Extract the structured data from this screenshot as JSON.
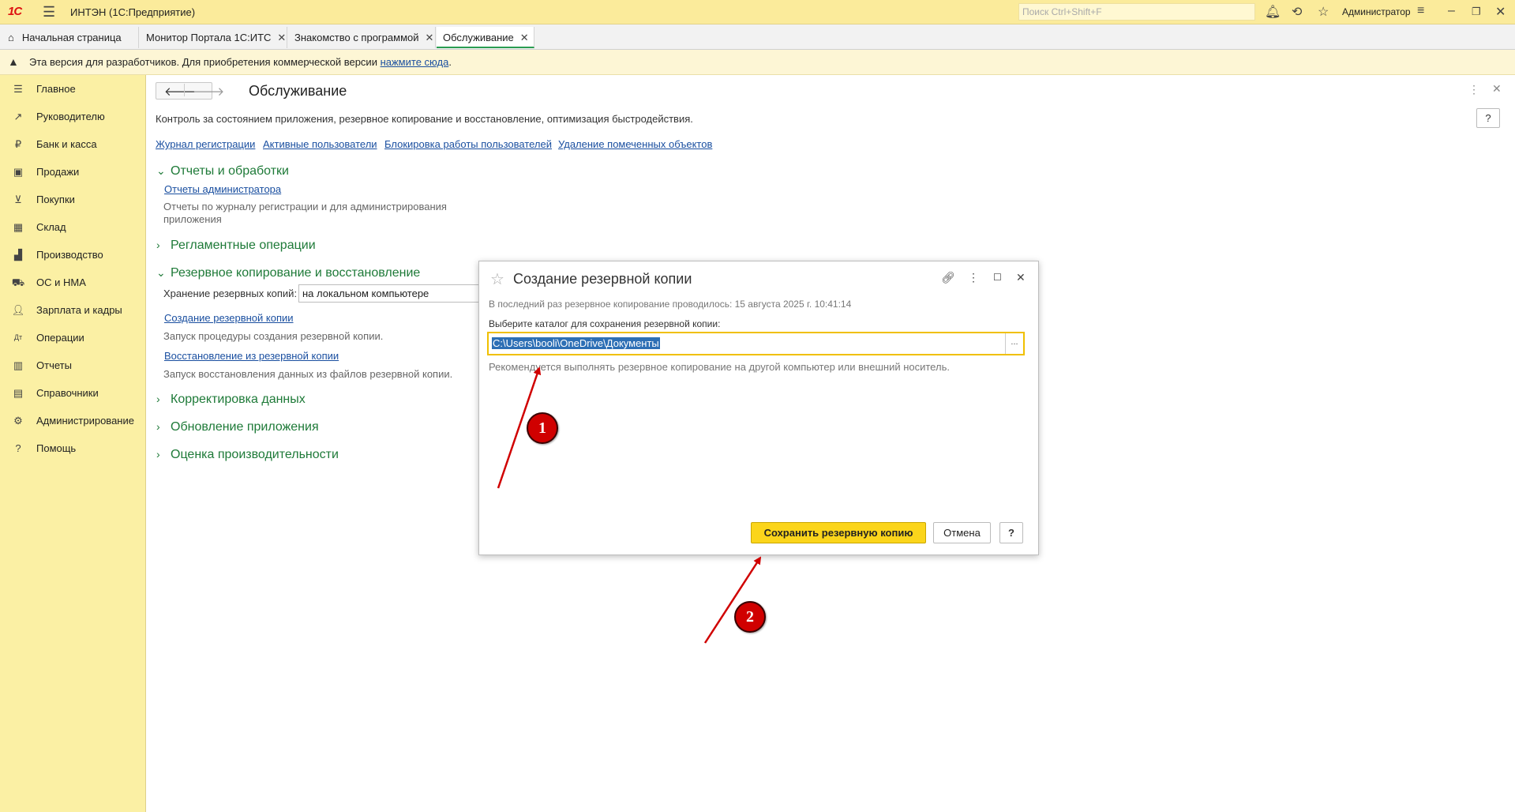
{
  "titlebar": {
    "logo": "1С",
    "app_title": "ИНТЭН  (1С:Предприятие)",
    "search_placeholder": "Поиск Ctrl+Shift+F",
    "user": "Администратор"
  },
  "tabs": [
    {
      "label": "Начальная страница"
    },
    {
      "label": "Монитор Портала 1С:ИТС"
    },
    {
      "label": "Знакомство с программой"
    },
    {
      "label": "Обслуживание"
    }
  ],
  "notice": {
    "text": "Эта версия для разработчиков. Для приобретения коммерческой версии ",
    "link": "нажмите сюда",
    "suffix": "."
  },
  "sidebar": {
    "items": [
      {
        "label": "Главное",
        "icon": "menu-icon"
      },
      {
        "label": "Руководителю",
        "icon": "trend-icon"
      },
      {
        "label": "Банк и касса",
        "icon": "ruble-icon"
      },
      {
        "label": "Продажи",
        "icon": "bag-icon"
      },
      {
        "label": "Покупки",
        "icon": "cart-icon"
      },
      {
        "label": "Склад",
        "icon": "grid-icon"
      },
      {
        "label": "Производство",
        "icon": "factory-icon"
      },
      {
        "label": "ОС и НМА",
        "icon": "truck-icon"
      },
      {
        "label": "Зарплата и кадры",
        "icon": "person-icon"
      },
      {
        "label": "Операции",
        "icon": "dt-kt-icon"
      },
      {
        "label": "Отчеты",
        "icon": "bar-chart-icon"
      },
      {
        "label": "Справочники",
        "icon": "book-icon"
      },
      {
        "label": "Администрирование",
        "icon": "gear-icon"
      },
      {
        "label": "Помощь",
        "icon": "question-icon"
      }
    ]
  },
  "page": {
    "title": "Обслуживание",
    "help": "?",
    "description": "Контроль за состоянием приложения, резервное копирование и восстановление, оптимизация быстродействия.",
    "links": [
      "Журнал регистрации",
      "Активные пользователи",
      "Блокировка работы пользователей",
      "Удаление помеченных объектов"
    ],
    "sections": {
      "reports": {
        "title": "Отчеты и обработки",
        "link": "Отчеты администратора",
        "desc": "Отчеты по журналу регистрации и для администрирования приложения"
      },
      "scheduled": {
        "title": "Регламентные операции"
      },
      "backup": {
        "title": "Резервное копирование и восстановление",
        "storage_label": "Хранение резервных копий:",
        "storage_value": "на локальном компьютере",
        "create_link": "Создание резервной копии",
        "create_desc": "Запуск процедуры создания резервной копии.",
        "restore_link": "Восстановление из резервной копии",
        "restore_desc": "Запуск восстановления данных из файлов резервной копии."
      },
      "data_fix": {
        "title": "Корректировка данных"
      },
      "update": {
        "title": "Обновление приложения"
      },
      "perf": {
        "title": "Оценка производительности"
      }
    }
  },
  "dialog": {
    "title": "Создание резервной копии",
    "last_backup": "В последний раз резервное копирование проводилось: 15 августа 2025 г. 10:41:14",
    "choose_label": "Выберите каталог для сохранения резервной копии:",
    "path": "C:\\Users\\booli\\OneDrive\\Документы",
    "path_button": "...",
    "hint": "Рекомендуется выполнять резервное копирование на другой компьютер или внешний носитель.",
    "save_button": "Сохранить резервную копию",
    "cancel_button": "Отмена",
    "help_button": "?"
  },
  "annotations": {
    "marker1": "1",
    "marker2": "2",
    "color": "#d00000"
  }
}
